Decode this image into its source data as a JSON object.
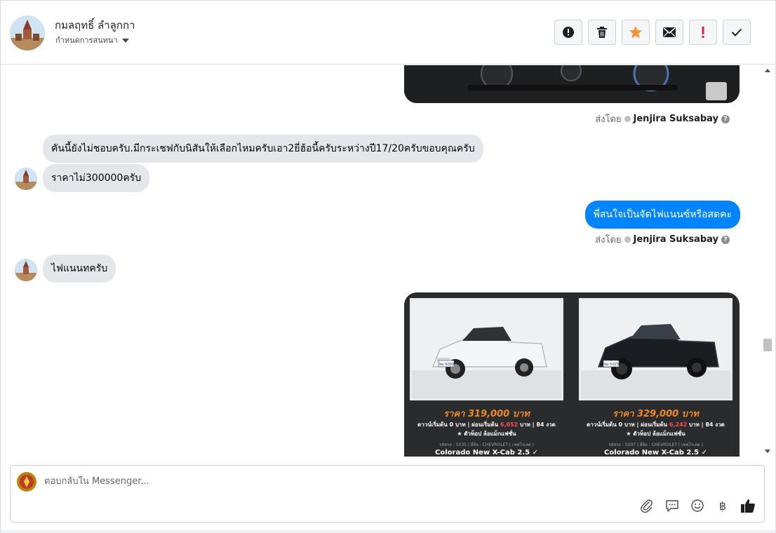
{
  "header": {
    "contact_name": "กมลฤทธิ์ ลำลูกกา",
    "assign_label": "กำหนดการสนทนา",
    "actions": [
      {
        "name": "mark-spam-button",
        "icon": "alert-circle-icon"
      },
      {
        "name": "delete-button",
        "icon": "trash-icon"
      },
      {
        "name": "star-button",
        "icon": "star-icon"
      },
      {
        "name": "mark-unread-button",
        "icon": "envelope-icon"
      },
      {
        "name": "follow-up-button",
        "icon": "exclamation-icon"
      },
      {
        "name": "mark-done-button",
        "icon": "checkmark-icon"
      }
    ]
  },
  "thread": {
    "sent_by_label": "ส่งโดย",
    "agent_name": "Jenjira Suksabay",
    "messages": {
      "m1": "คันนี้ยังไม่ชอบครับ.มีกระเชฟกับนิสันให้เลือกไหมครับเอา2ยี่ฮ้อนี้ครับระหว่างปี17/20ครับขอบคุณครับ",
      "m2": "ราคาไม่300000ครับ",
      "m3": "พี่สนใจเป็นจัดไฟแนนซ์หรือสดคะ",
      "m4": "ไฟแนนทครับ"
    },
    "cars": [
      {
        "price": "ราคา 319,000 บาท",
        "down_prefix": "ดาวน์เริ่มต้น 0 บาท | ผ่อนเริ่มต้น",
        "installment": "6,052",
        "down_suffix": "บาท | 84 งวด",
        "feature": "★ ตัวท็อป ล้อแม็กแฟชั่น",
        "meta": "รหัสรถ : 5035 | ยี่ห้อ : CHEVROLET ( เชฟโรเลต )",
        "model": "Colorado New X-Cab 2.5 ✓",
        "color": "#f4f5f7",
        "plate": "3ฒ 9000"
      },
      {
        "price": "ราคา 329,000 บาท",
        "down_prefix": "ดาวน์เริ่มต้น 0 บาท | ผ่อนเริ่มต้น",
        "installment": "6,242",
        "down_suffix": "บาท | 84 งวด",
        "feature": "★ ตัวท็อป ล้อแม็กแฟชั่น",
        "meta": "รหัสรถ : 5007 | ยี่ห้อ : CHEVROLET ( เชฟโรเลต )",
        "model": "Colorado New X-Cab 2.5 ✓",
        "color": "#1c1d22",
        "plate": "3ฒ 5025"
      }
    ]
  },
  "composer": {
    "placeholder": "ตอบกลับใน Messenger...",
    "tools": [
      "paperclip-icon",
      "saved-reply-icon",
      "emoji-icon",
      "baht-icon",
      "thumbs-up-icon"
    ],
    "baht_glyph": "฿"
  },
  "colors": {
    "outgoing_bubble": "#0084ff",
    "incoming_bubble": "#e4e6eb",
    "star": "#f7923a",
    "follow_up": "#e41e3f"
  }
}
